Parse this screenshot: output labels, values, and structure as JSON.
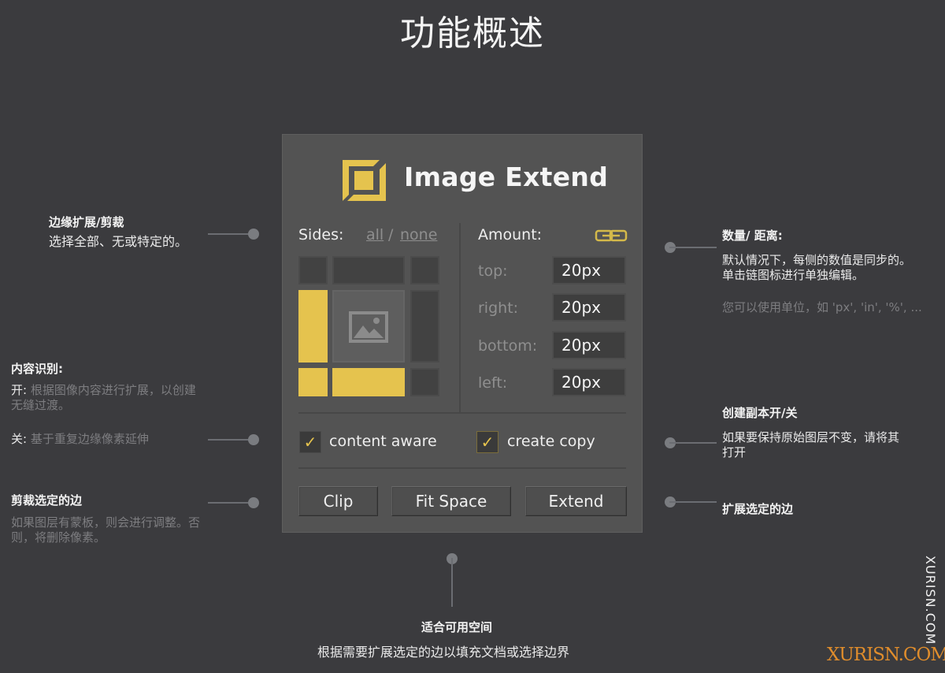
{
  "page": {
    "title": "功能概述"
  },
  "panel": {
    "app_title": "Image Extend",
    "logo_icon": "image-extend-logo-icon",
    "accent_color": "#e5c34e",
    "sides": {
      "label": "Sides:",
      "all_link": "all",
      "slash": "/",
      "none_link": "none",
      "grid": {
        "top_left": false,
        "top": false,
        "top_right": false,
        "left": true,
        "right": false,
        "bottom_left": true,
        "bottom": true,
        "bottom_right": false
      },
      "center_icon": "image-placeholder-icon"
    },
    "amount": {
      "label": "Amount:",
      "link_icon": "chain-link-icon",
      "fields": [
        {
          "label": "top:",
          "value": "20px"
        },
        {
          "label": "right:",
          "value": "20px"
        },
        {
          "label": "bottom:",
          "value": "20px"
        },
        {
          "label": "left:",
          "value": "20px"
        }
      ]
    },
    "options": {
      "content_aware": {
        "label": "content aware",
        "checked": true
      },
      "create_copy": {
        "label": "create copy",
        "checked": true
      }
    },
    "buttons": {
      "clip": "Clip",
      "fit_space": "Fit Space",
      "extend": "Extend"
    }
  },
  "annotations": {
    "sides": {
      "title": "边缘扩展/剪裁",
      "text": "选择全部、无或特定的。"
    },
    "content_aware": {
      "title": "内容识别:",
      "on_prefix": "开:",
      "on_text": " 根据图像内容进行扩展，以创建",
      "on_text2": "无缝过渡。",
      "off_prefix": "关:",
      "off_text": " 基于重复边缘像素延伸"
    },
    "clip": {
      "title": "剪裁选定的边",
      "text1": "如果图层有蒙板，则会进行调整。否",
      "text2": "则，将删除像素。"
    },
    "amount": {
      "title": "数量/ 距离:",
      "text1": "默认情况下，每侧的数值是同步的。",
      "text2": "单击链图标进行单独编辑。",
      "hint": "您可以使用单位，如 'px', 'in', '%', ..."
    },
    "create_copy": {
      "title": "创建副本开/关",
      "text1": "如果要保持原始图层不变，请将其",
      "text2": "打开"
    },
    "extend": {
      "title": "扩展选定的边"
    },
    "fit_space": {
      "title": "适合可用空间",
      "text": "根据需要扩展选定的边以填充文档或选择边界"
    }
  },
  "watermark": {
    "vertical": "XURISN.COM",
    "horizontal": "XURISN.COM"
  }
}
